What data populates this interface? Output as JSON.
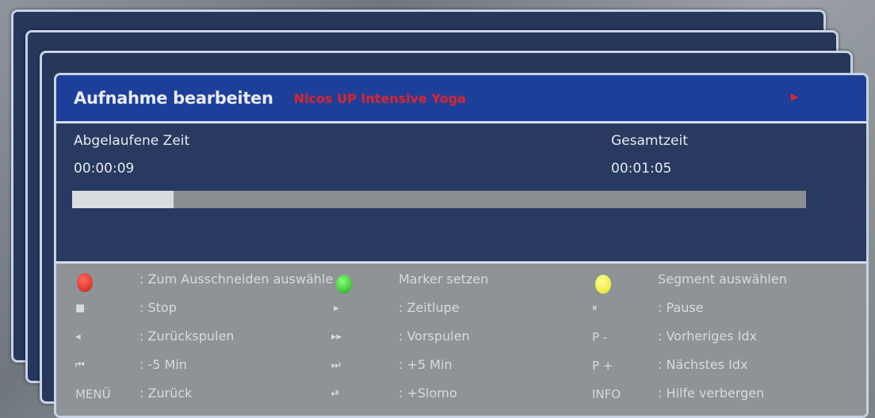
{
  "window": {
    "title": "Aufnahme bearbeiten",
    "recording_name": "Nicos UP Intensive Yoga",
    "arrow_icon": "right-arrow-icon"
  },
  "time": {
    "elapsed_label": "Abgelaufene Zeit",
    "elapsed_value": "00:00:09",
    "total_label": "Gesamtzeit",
    "total_value": "00:01:05",
    "progress_fraction": 0.138
  },
  "colors": {
    "header": "#1e3f99",
    "panel": "#2a3a5e",
    "help_bg": "#8f9296",
    "red": "#d4281f",
    "green": "#23c323",
    "yellow": "#f0ea2a",
    "recording_name": "#e0262e"
  },
  "help": {
    "col1": [
      {
        "key": "",
        "key_icon": "red-button-icon",
        "text": ": Zum Ausschneiden auswähle"
      },
      {
        "key": "■",
        "key_icon": "stop-icon",
        "text": ": Stop"
      },
      {
        "key": "◂",
        "key_icon": "rewind-icon",
        "text": ": Zurückspulen"
      },
      {
        "key": "⏮",
        "key_icon": "skip-back-icon",
        "text": ": -5 Min"
      },
      {
        "key": "MENÜ",
        "key_icon": "",
        "text": ": Zurück"
      }
    ],
    "col2": [
      {
        "key": "",
        "key_icon": "green-button-icon",
        "text": "Marker setzen"
      },
      {
        "key": "▸",
        "key_icon": "play-icon",
        "text": ": Zeitlupe"
      },
      {
        "key": "▸▸",
        "key_icon": "fast-forward-icon",
        "text": ": Vorspulen"
      },
      {
        "key": "⏭",
        "key_icon": "skip-forward-icon",
        "text": ": +5 Min"
      },
      {
        "key": "⏯",
        "key_icon": "slomo-icon",
        "text": ": +Slomo"
      }
    ],
    "col3": [
      {
        "key": "",
        "key_icon": "yellow-button-icon",
        "text": "Segment auswählen"
      },
      {
        "key": "⏸",
        "key_icon": "pause-icon",
        "text": ": Pause"
      },
      {
        "key": "P -",
        "key_icon": "",
        "text": ": Vorheriges Idx"
      },
      {
        "key": "P +",
        "key_icon": "",
        "text": ": Nächstes Idx"
      },
      {
        "key": "INFO",
        "key_icon": "",
        "text": ": Hilfe verbergen"
      }
    ]
  }
}
